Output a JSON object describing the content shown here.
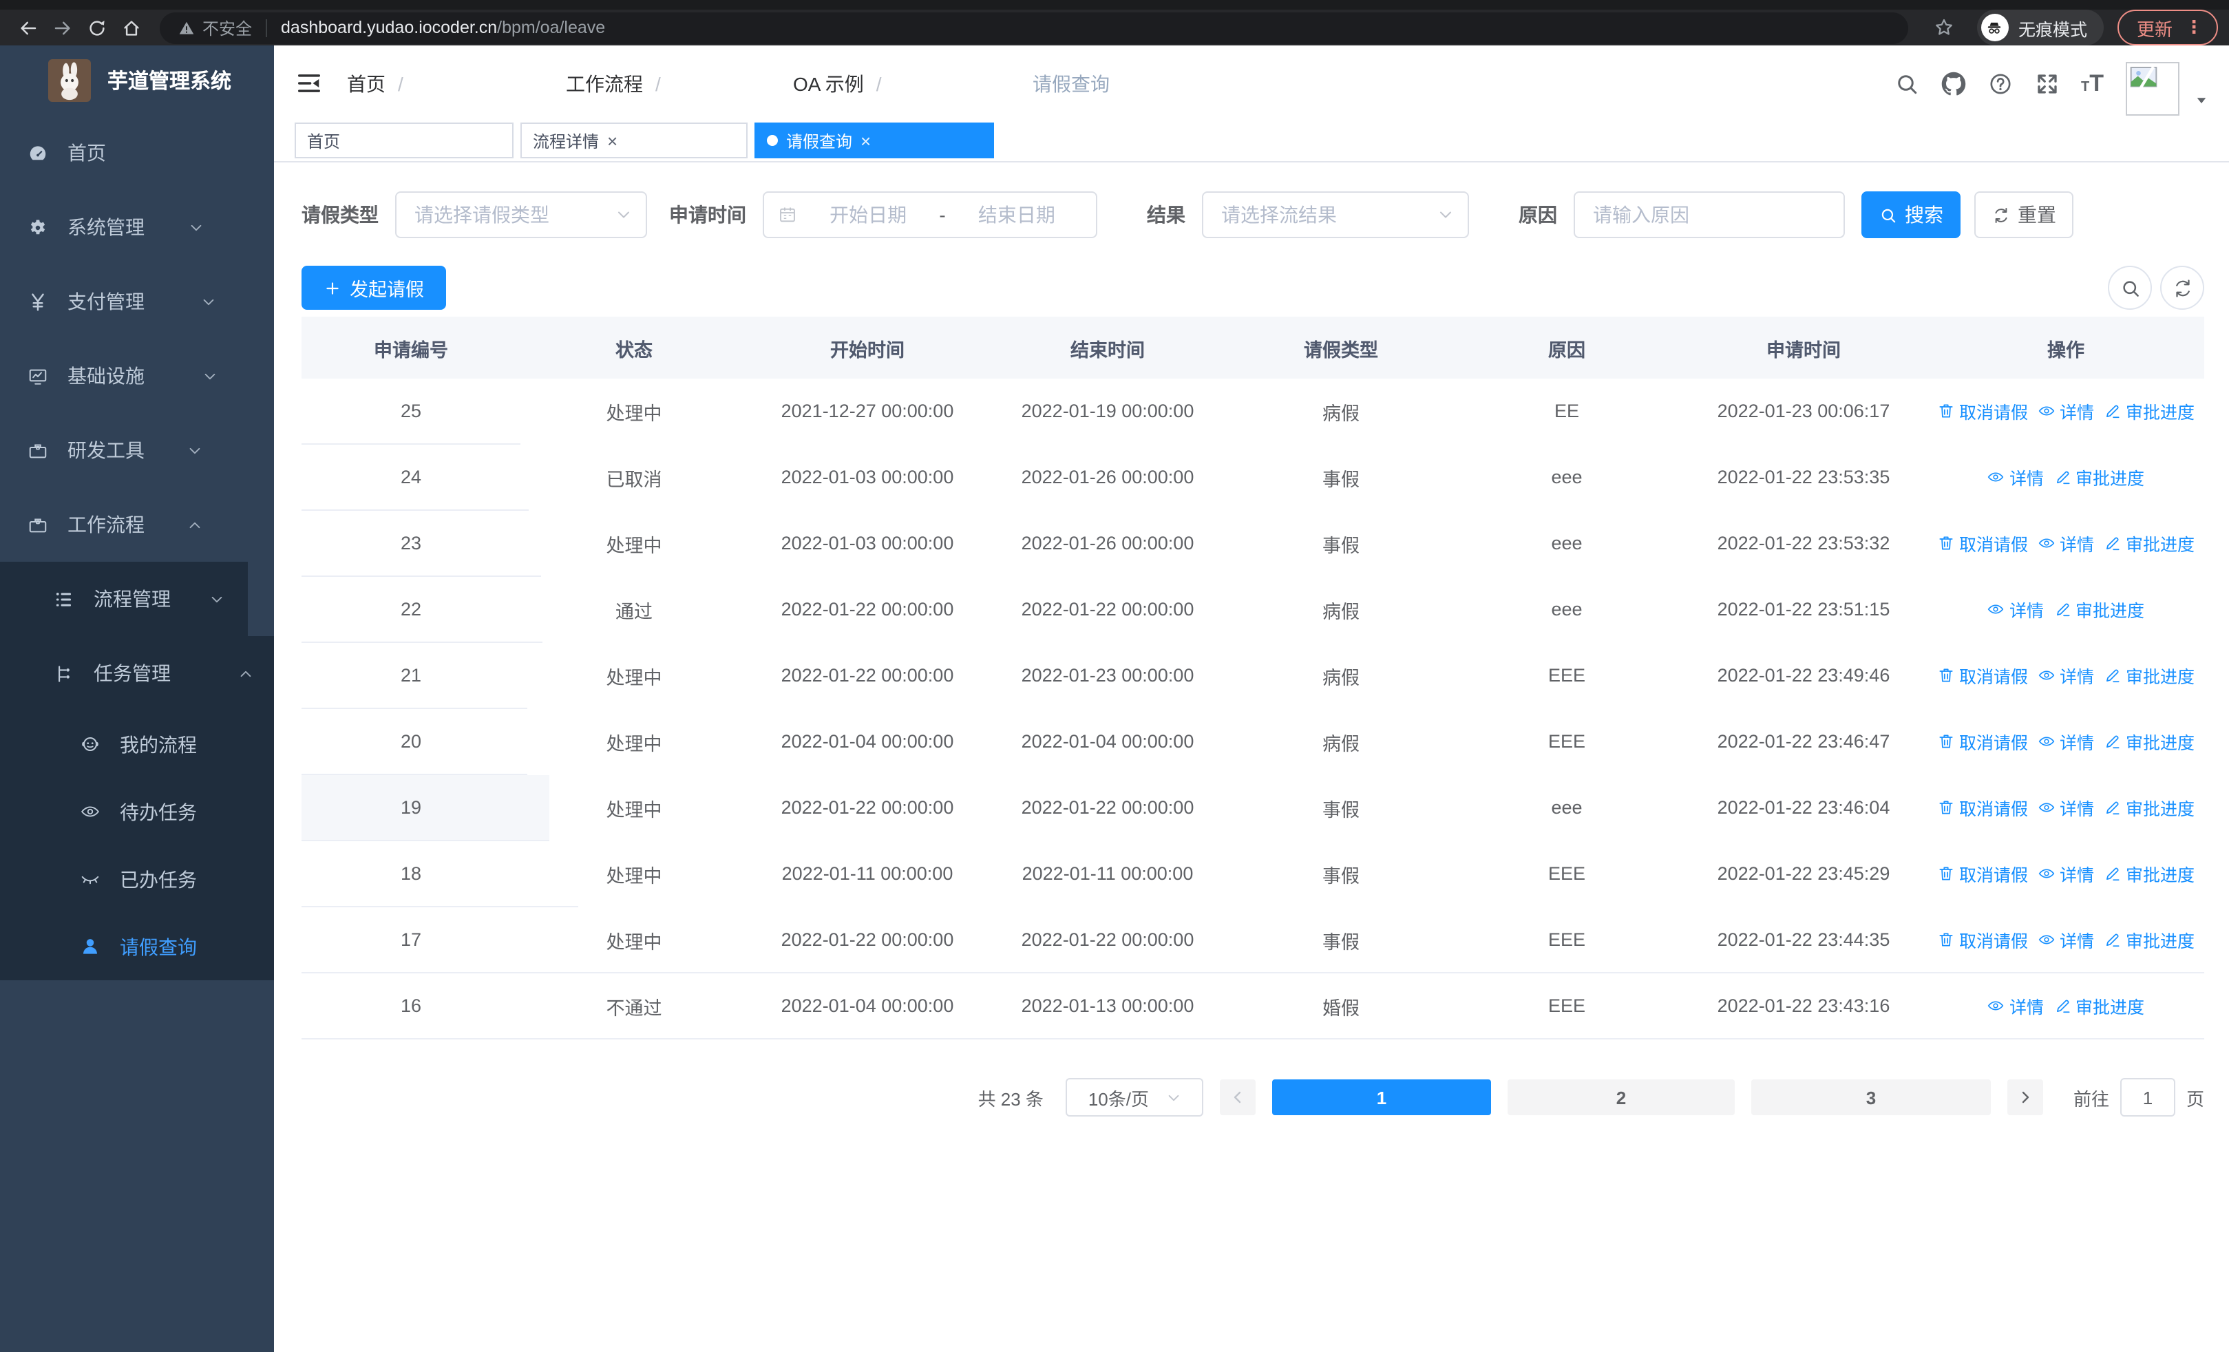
{
  "browser": {
    "security": "不安全",
    "host": "dashboard.yudao.iocoder.cn",
    "path": "/bpm/oa/leave",
    "incognito": "无痕模式",
    "update": "更新"
  },
  "sidebar": {
    "title": "芋道管理系统",
    "items": [
      {
        "label": "首页",
        "icon": "dashboard-icon",
        "cls": "lv1"
      },
      {
        "label": "系统管理",
        "icon": "gear-icon",
        "cls": "lv1",
        "chevron": "down"
      },
      {
        "label": "支付管理",
        "icon": "yen-icon",
        "cls": "lv1",
        "chevron": "down"
      },
      {
        "label": "基础设施",
        "icon": "monitor-icon",
        "cls": "lv1",
        "chevron": "down"
      },
      {
        "label": "研发工具",
        "icon": "toolbox-icon",
        "cls": "lv1",
        "chevron": "down"
      },
      {
        "label": "工作流程",
        "icon": "briefcase-icon",
        "cls": "lv1",
        "chevron": "up"
      },
      {
        "label": "流程管理",
        "icon": "list-icon",
        "cls": "lv2",
        "chevron": "down",
        "sub": true
      },
      {
        "label": "任务管理",
        "icon": "flow-icon",
        "cls": "lv2",
        "chevron": "up",
        "sub": true
      },
      {
        "label": "我的流程",
        "icon": "robot-icon",
        "cls": "lv3",
        "sub": true
      },
      {
        "label": "待办任务",
        "icon": "eye-icon",
        "cls": "lv3",
        "sub": true
      },
      {
        "label": "已办任务",
        "icon": "eye-closed-icon",
        "cls": "lv3",
        "sub": true
      },
      {
        "label": "请假查询",
        "icon": "user-icon",
        "cls": "lv3",
        "sub": true,
        "active": true
      }
    ]
  },
  "header": {
    "breadcrumb": [
      "首页",
      "工作流程",
      "OA 示例",
      "请假查询"
    ]
  },
  "tabs": [
    {
      "label": "首页"
    },
    {
      "label": "流程详情",
      "closable": true
    },
    {
      "label": "请假查询",
      "closable": true,
      "active": true
    }
  ],
  "filters": {
    "type_label": "请假类型",
    "type_placeholder": "请选择请假类型",
    "time_label": "申请时间",
    "start_placeholder": "开始日期",
    "separator": "-",
    "end_placeholder": "结束日期",
    "result_label": "结果",
    "result_placeholder": "请选择流结果",
    "reason_label": "原因",
    "reason_placeholder": "请输入原因",
    "search": "搜索",
    "reset": "重置"
  },
  "toolbar": {
    "create": "发起请假"
  },
  "table": {
    "columns": [
      "申请编号",
      "状态",
      "开始时间",
      "结束时间",
      "请假类型",
      "原因",
      "申请时间",
      "操作"
    ],
    "action_labels": {
      "cancel": "取消请假",
      "detail": "详情",
      "progress": "审批进度"
    },
    "rows": [
      {
        "id": "25",
        "status": "处理中",
        "start": "2021-12-27 00:00:00",
        "end": "2022-01-19 00:00:00",
        "type": "病假",
        "reason": "EE",
        "applied": "2022-01-23 00:06:17",
        "cancelable": true
      },
      {
        "id": "24",
        "status": "已取消",
        "start": "2022-01-03 00:00:00",
        "end": "2022-01-26 00:00:00",
        "type": "事假",
        "reason": "eee",
        "applied": "2022-01-22 23:53:35",
        "cancelable": false
      },
      {
        "id": "23",
        "status": "处理中",
        "start": "2022-01-03 00:00:00",
        "end": "2022-01-26 00:00:00",
        "type": "事假",
        "reason": "eee",
        "applied": "2022-01-22 23:53:32",
        "cancelable": true
      },
      {
        "id": "22",
        "status": "通过",
        "start": "2022-01-22 00:00:00",
        "end": "2022-01-22 00:00:00",
        "type": "病假",
        "reason": "eee",
        "applied": "2022-01-22 23:51:15",
        "cancelable": false
      },
      {
        "id": "21",
        "status": "处理中",
        "start": "2022-01-22 00:00:00",
        "end": "2022-01-23 00:00:00",
        "type": "病假",
        "reason": "EEE",
        "applied": "2022-01-22 23:49:46",
        "cancelable": true
      },
      {
        "id": "20",
        "status": "处理中",
        "start": "2022-01-04 00:00:00",
        "end": "2022-01-04 00:00:00",
        "type": "病假",
        "reason": "EEE",
        "applied": "2022-01-22 23:46:47",
        "cancelable": true
      },
      {
        "id": "19",
        "status": "处理中",
        "start": "2022-01-22 00:00:00",
        "end": "2022-01-22 00:00:00",
        "type": "事假",
        "reason": "eee",
        "applied": "2022-01-22 23:46:04",
        "cancelable": true,
        "highlighted": true
      },
      {
        "id": "18",
        "status": "处理中",
        "start": "2022-01-11 00:00:00",
        "end": "2022-01-11 00:00:00",
        "type": "事假",
        "reason": "EEE",
        "applied": "2022-01-22 23:45:29",
        "cancelable": true
      },
      {
        "id": "17",
        "status": "处理中",
        "start": "2022-01-22 00:00:00",
        "end": "2022-01-22 00:00:00",
        "type": "事假",
        "reason": "EEE",
        "applied": "2022-01-22 23:44:35",
        "cancelable": true
      },
      {
        "id": "16",
        "status": "不通过",
        "start": "2022-01-04 00:00:00",
        "end": "2022-01-13 00:00:00",
        "type": "婚假",
        "reason": "EEE",
        "applied": "2022-01-22 23:43:16",
        "cancelable": false
      }
    ]
  },
  "pagination": {
    "total": "共 23 条",
    "page_size": "10条/页",
    "pages": [
      {
        "n": "1",
        "active": true
      },
      {
        "n": "2"
      },
      {
        "n": "3"
      }
    ],
    "goto": "前往",
    "goto_value": "1",
    "unit": "页"
  },
  "colors": {
    "primary": "#1890ff",
    "sidebar_bg": "#304156",
    "sidebar_submenu_bg": "#1f2d3d",
    "update_accent": "#ee8e86"
  }
}
